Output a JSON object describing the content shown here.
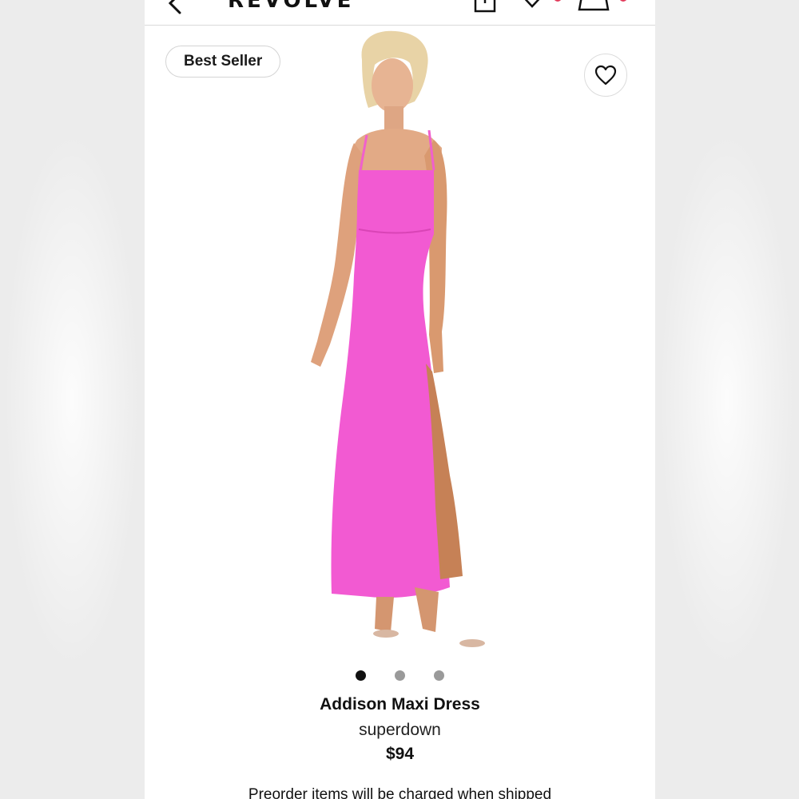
{
  "header": {
    "brand": "REVOLVE",
    "icons": [
      "back-arrow-icon",
      "share-icon",
      "heart-icon",
      "shopping-bag-icon"
    ]
  },
  "product": {
    "badge": "Best Seller",
    "name": "Addison Maxi Dress",
    "brand": "superdown",
    "price": "$94",
    "image": "pink-maxi-dress-model-photo",
    "dress_color": "#f25ad2",
    "carousel": {
      "total": 3,
      "active": 1
    }
  },
  "notice": "Preorder items will be charged when shipped",
  "colors": {
    "accent": "#e23b5b",
    "text": "#111111"
  }
}
